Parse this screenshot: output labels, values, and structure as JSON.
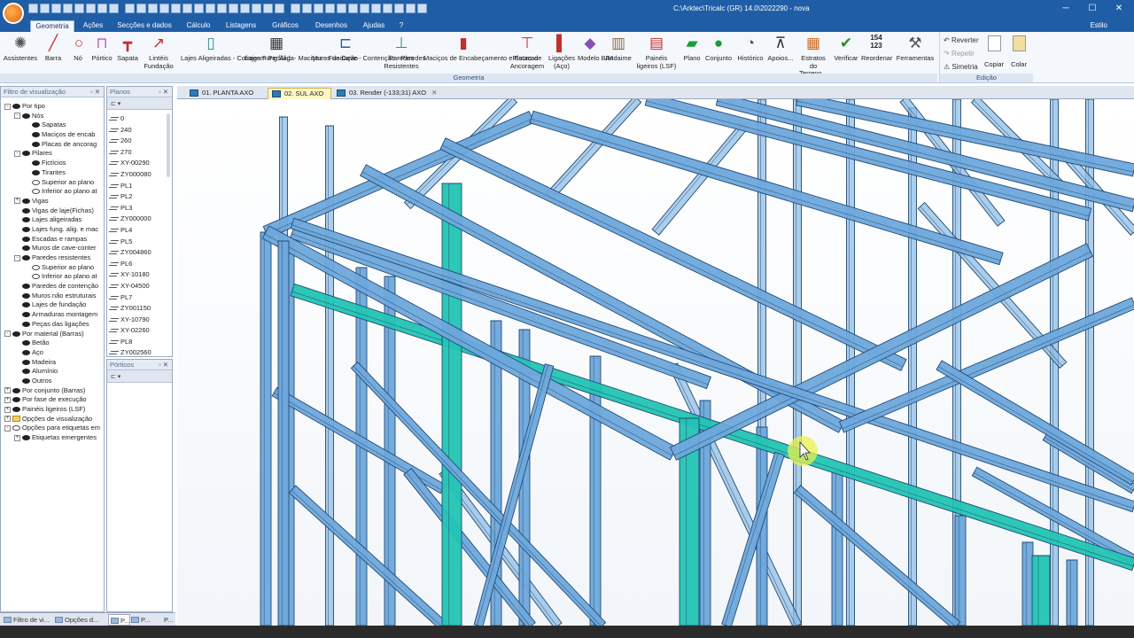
{
  "window": {
    "title": "C:\\Arktec\\Tricalc (GR) 14.0\\2022290 - nova",
    "minimize": "─",
    "maximize": "☐",
    "close": "✕"
  },
  "ribbon_tabs": [
    "Geometria",
    "Ações",
    "Secções e dados",
    "Cálculo",
    "Listagens",
    "Gráficos",
    "Desenhos",
    "Ajudas",
    "?"
  ],
  "style_label": "Estilo",
  "ribbon": {
    "buttons": [
      {
        "label": "Assistentes",
        "icon": "wizard-icon"
      },
      {
        "label": "Barra",
        "icon": "bar-icon"
      },
      {
        "label": "Nó",
        "icon": "node-icon"
      },
      {
        "label": "Pórtico",
        "icon": "portal-frame-icon"
      },
      {
        "label": "Sapata",
        "icon": "footing-icon"
      },
      {
        "label": "Lintéis Fundação",
        "icon": "foundation-beam-icon"
      },
      {
        "label": "Lajes Aligeiradas - Cofragem Perfilada",
        "icon": "lightweight-slab-icon"
      },
      {
        "label": "Lajes Fung.Alig. - Maciças - Fundação",
        "icon": "waffle-slab-icon"
      },
      {
        "label": "Muros de Cave - Contenção - Paredes",
        "icon": "basement-wall-icon"
      },
      {
        "label": "Paredes Resistentes",
        "icon": "bearing-wall-icon"
      },
      {
        "label": "Maciços de Encabeçamento e Estacas",
        "icon": "pile-cap-icon"
      },
      {
        "label": "Placas de Ancoragem",
        "icon": "anchor-plate-icon"
      },
      {
        "label": "Ligações (Aço)",
        "icon": "steel-connection-icon"
      },
      {
        "label": "Modelo BIM",
        "icon": "bim-model-icon"
      },
      {
        "label": "Andaime",
        "icon": "scaffold-icon"
      },
      {
        "label": "Painéis ligeiros (LSF)",
        "icon": "lsf-panel-icon"
      },
      {
        "label": "Plano",
        "icon": "plane-icon"
      },
      {
        "label": "Conjunto",
        "icon": "group-icon"
      },
      {
        "label": "Histórico",
        "icon": "history-icon"
      },
      {
        "label": "Apoios...",
        "icon": "supports-icon"
      },
      {
        "label": "Estratos do Terreno...",
        "icon": "soil-layers-icon"
      },
      {
        "label": "Verificar",
        "icon": "check-icon"
      },
      {
        "label": "Reordenar",
        "icon": "renumber-icon",
        "icon_text": "154 123"
      },
      {
        "label": "Ferramentas",
        "icon": "tools-icon"
      }
    ],
    "group_geometria": "Geometria",
    "edit": {
      "undo": "Reverter",
      "redo": "Repetir",
      "symmetry": "Simetria",
      "copy": "Copiar",
      "paste": "Colar",
      "group": "Edição"
    }
  },
  "panels": {
    "filter": {
      "title": "Filtro de visualização",
      "controls": "▫ ✕",
      "tree": [
        {
          "l": "Por tipo",
          "d": 0,
          "ex": "-",
          "eye": true
        },
        {
          "l": "Nós",
          "d": 1,
          "ex": "-",
          "eye": true
        },
        {
          "l": "Sapatas",
          "d": 2,
          "eye": true
        },
        {
          "l": "Maciços de encab",
          "d": 2,
          "eye": true
        },
        {
          "l": "Placas de ancorag",
          "d": 2,
          "eye": true
        },
        {
          "l": "Pilares",
          "d": 1,
          "ex": "-",
          "eye": true
        },
        {
          "l": "Fictícios",
          "d": 2,
          "eye": true
        },
        {
          "l": "Tirantes",
          "d": 2,
          "eye": true
        },
        {
          "l": "Superior ao plano",
          "d": 2,
          "eye": false
        },
        {
          "l": "Inferior ao plano at",
          "d": 2,
          "eye": false
        },
        {
          "l": "Vigas",
          "d": 1,
          "ex": "+",
          "eye": true
        },
        {
          "l": "Vigas de laje(Fichas)",
          "d": 1,
          "eye": true
        },
        {
          "l": "Lajes aligeiradas",
          "d": 1,
          "eye": true
        },
        {
          "l": "Lajes fung. alig. e mac",
          "d": 1,
          "eye": true
        },
        {
          "l": "Escadas e rampas",
          "d": 1,
          "eye": true
        },
        {
          "l": "Muros de cave-conter",
          "d": 1,
          "eye": true
        },
        {
          "l": "Paredes resistentes",
          "d": 1,
          "ex": "-",
          "eye": true
        },
        {
          "l": "Superior ao plano",
          "d": 2,
          "eye": false
        },
        {
          "l": "Inferior ao plano at",
          "d": 2,
          "eye": false
        },
        {
          "l": "Paredes de contenção",
          "d": 1,
          "eye": true
        },
        {
          "l": "Muros não estruturais",
          "d": 1,
          "eye": true
        },
        {
          "l": "Lajes de fundação",
          "d": 1,
          "eye": true
        },
        {
          "l": "Armaduras montagem",
          "d": 1,
          "eye": true
        },
        {
          "l": "Peças das ligações",
          "d": 1,
          "eye": true
        },
        {
          "l": "Por material (Barras)",
          "d": 0,
          "ex": "-",
          "eye": true
        },
        {
          "l": "Betão",
          "d": 1,
          "eye": true
        },
        {
          "l": "Aço",
          "d": 1,
          "eye": true
        },
        {
          "l": "Madeira",
          "d": 1,
          "eye": true
        },
        {
          "l": "Alumínio",
          "d": 1,
          "eye": true
        },
        {
          "l": "Outros",
          "d": 1,
          "eye": true
        },
        {
          "l": "Por conjunto (Barras)",
          "d": 0,
          "ex": "+",
          "eye": true
        },
        {
          "l": "Por fase de execução",
          "d": 0,
          "ex": "+",
          "eye": true
        },
        {
          "l": "Painéis ligeiros (LSF)",
          "d": 0,
          "ex": "+",
          "eye": true
        },
        {
          "l": "Opções de visualização",
          "d": 0,
          "ex": "+",
          "folder": true
        },
        {
          "l": "Opções para etiquetas em",
          "d": 0,
          "ex": "-",
          "eyeo": true
        },
        {
          "l": "Etiquetas emergentes",
          "d": 1,
          "ex": "+",
          "eye": true
        }
      ]
    },
    "planes": {
      "title": "Planos",
      "controls": "▫ ✕",
      "items": [
        "0",
        "240",
        "260",
        "270",
        "XY-00290",
        "ZY000080",
        "PL1",
        "PL2",
        "PL3",
        "ZY000000",
        "PL4",
        "PL5",
        "ZY004860",
        "PL6",
        "XY-10180",
        "XY-04500",
        "PL7",
        "ZY001150",
        "XY-10790",
        "XY-02260",
        "PL8",
        "ZY002560"
      ]
    },
    "porticos": {
      "title": "Pórticos",
      "controls": "▫ ✕"
    }
  },
  "doc_tabs": [
    {
      "label": "01. PLANTA   AXO",
      "active": false
    },
    {
      "label": "02. SUL   AXO",
      "active": true
    },
    {
      "label": "03. Render (-133;31)  AXO",
      "active": false,
      "close": "✕"
    }
  ],
  "status_tabs": [
    "Filtro de vi...",
    "Opções d...",
    "P...",
    "P...",
    "P..."
  ],
  "colors": {
    "frame": "#6ea8dc",
    "frame_edge": "#234a74",
    "highlight": "#22c4b4",
    "cursor": "#e6f04a"
  }
}
